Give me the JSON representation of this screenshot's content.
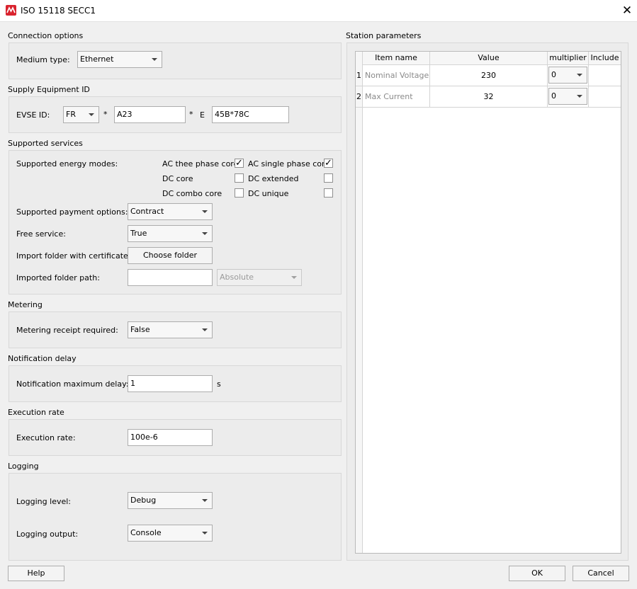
{
  "window": {
    "title": "ISO 15118 SECC1",
    "close_glyph": "✕"
  },
  "connection": {
    "section": "Connection options",
    "medium_label": "Medium type:",
    "medium_value": "Ethernet"
  },
  "supply": {
    "section": "Supply Equipment ID",
    "evse_label": "EVSE ID:",
    "country_value": "FR",
    "sep1": "*",
    "operator_value": "A23",
    "sep2": "*",
    "e_label": "E",
    "id_value": "45B*78C"
  },
  "services": {
    "section": "Supported services",
    "energy_label": "Supported energy modes:",
    "modes": [
      {
        "label": "AC thee phase core",
        "checked": true,
        "mark": "✓"
      },
      {
        "label": "AC single phase core",
        "checked": true,
        "mark": "✓"
      },
      {
        "label": "DC core",
        "checked": false,
        "mark": ""
      },
      {
        "label": "DC extended",
        "checked": false,
        "mark": ""
      },
      {
        "label": "DC combo core",
        "checked": false,
        "mark": ""
      },
      {
        "label": "DC unique",
        "checked": false,
        "mark": ""
      }
    ],
    "payment_label": "Supported payment options:",
    "payment_value": "Contract",
    "free_label": "Free service:",
    "free_value": "True",
    "import_label": "Import folder with certificates:",
    "choose_button": "Choose folder",
    "path_label": "Imported folder path:",
    "path_value": "",
    "path_mode_value": "Absolute"
  },
  "metering": {
    "section": "Metering",
    "receipt_label": "Metering receipt required:",
    "receipt_value": "False"
  },
  "notification": {
    "section": "Notification delay",
    "max_label": "Notification maximum delay:",
    "max_value": "1",
    "unit": "s"
  },
  "execution": {
    "section": "Execution rate",
    "rate_label": "Execution rate:",
    "rate_value": "100e-6"
  },
  "logging": {
    "section": "Logging",
    "level_label": "Logging level:",
    "level_value": "Debug",
    "output_label": "Logging output:",
    "output_value": "Console"
  },
  "station": {
    "section": "Station parameters",
    "columns": [
      "Item name",
      "Value",
      "multiplier",
      "Include"
    ],
    "rows": [
      {
        "num": "1",
        "name": "Nominal Voltage",
        "value": "230",
        "multiplier": "0",
        "include": ""
      },
      {
        "num": "2",
        "name": "Max Current",
        "value": "32",
        "multiplier": "0",
        "include": ""
      }
    ]
  },
  "footer": {
    "help": "Help",
    "ok": "OK",
    "cancel": "Cancel"
  },
  "colors": {
    "app_icon": "#d9232e",
    "background": "#f0f0f0",
    "group": "#ececec"
  }
}
